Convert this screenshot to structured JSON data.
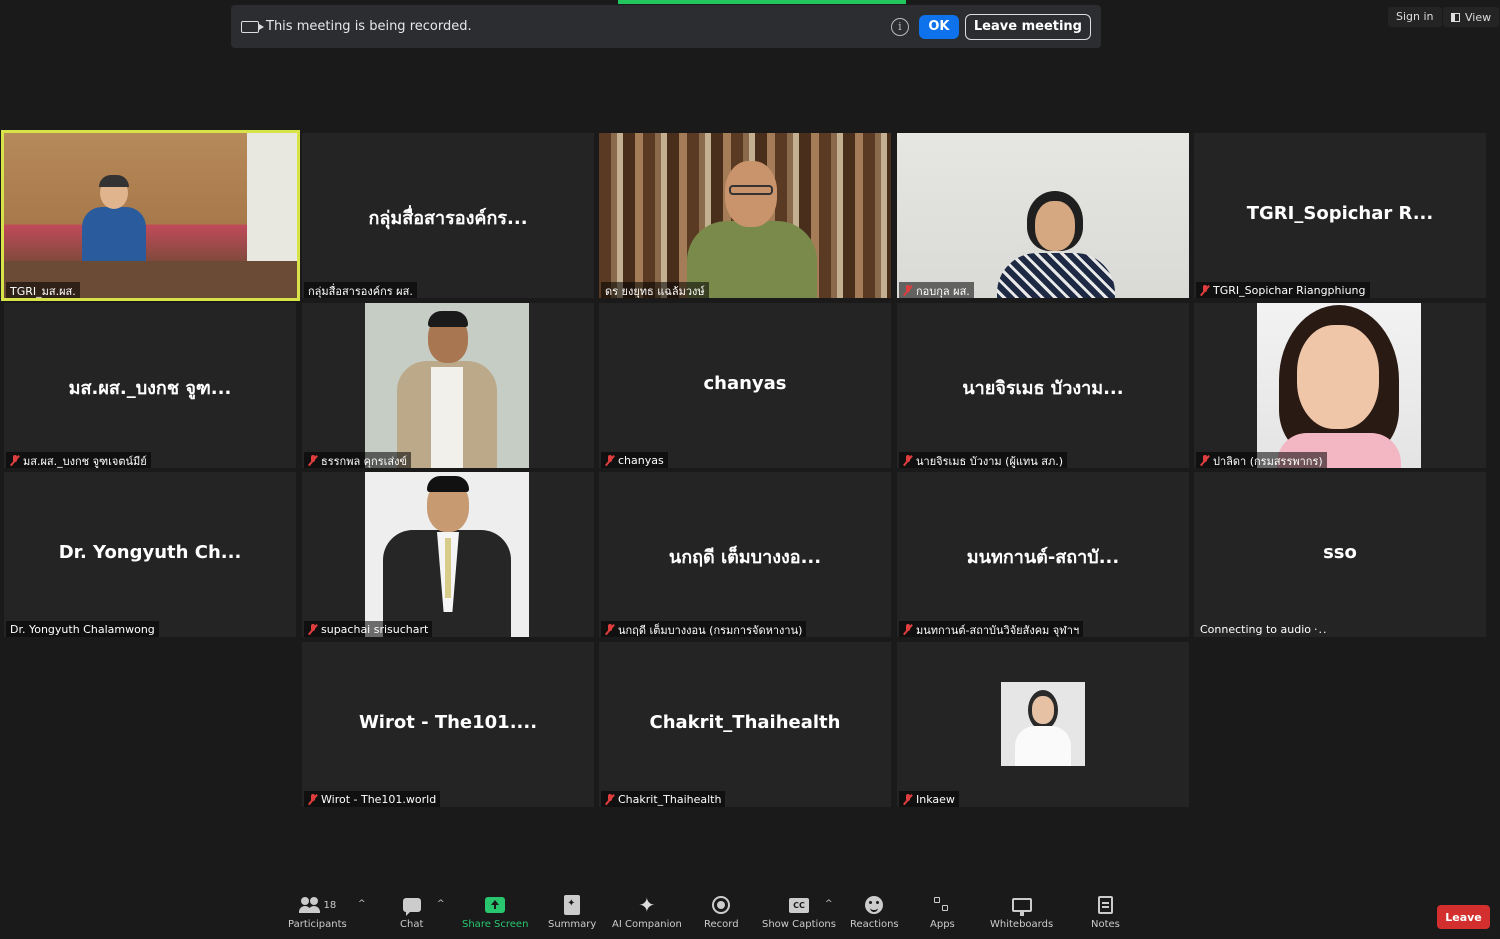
{
  "banner": {
    "text": "This meeting is being recorded.",
    "ok_label": "OK",
    "leave_meeting_label": "Leave meeting"
  },
  "top_right": {
    "sign_in_label": "Sign in",
    "view_label": "View"
  },
  "tiles": [
    {
      "display": "",
      "label": "TGRI_มส.ผส.",
      "muted": false,
      "active": true
    },
    {
      "display": "กลุ่มสื่อสารองค์กร...",
      "label": "กลุ่มสื่อสารองค์กร ผส.",
      "muted": false
    },
    {
      "display": "",
      "label": "ดร ยงยุทธ แฉล้มวงษ์",
      "muted": false
    },
    {
      "display": "",
      "label": "กอบกุล ผส.",
      "muted": true
    },
    {
      "display": "TGRI_Sopichar  R...",
      "label": "TGRI_Sopichar Riangphiung",
      "muted": true
    },
    {
      "display": "มส.ผส._บงกช จูฑ...",
      "label": "มส.ผส._บงกช จูฑเจตน์มีย์",
      "muted": true
    },
    {
      "display": "",
      "label": "ธรรกพล คุกรเส่งข์",
      "muted": true
    },
    {
      "display": "chanyas",
      "label": "chanyas",
      "muted": true
    },
    {
      "display": "นายจิรเมธ บัวงาม...",
      "label": "นายจิรเมธ บัวงาม (ผู้แทน สภ.)",
      "muted": true
    },
    {
      "display": "",
      "label": "ปาลิดา (กรมสรรพากร)",
      "muted": true
    },
    {
      "display": "Dr. Yongyuth  Ch...",
      "label": "Dr. Yongyuth Chalamwong",
      "muted": false
    },
    {
      "display": "",
      "label": "supachai srisuchart",
      "muted": true
    },
    {
      "display": "นกฤดี  เต็มบางงอ...",
      "label": "นกฤดี  เต็มบางงอน (กรมการจัดหางาน)",
      "muted": true
    },
    {
      "display": "มนทกานต์-สถาบั...",
      "label": "มนทกานต์-สถาบันวิจัยสังคม จุฬาฯ",
      "muted": true
    },
    {
      "display": "sso",
      "label": "Connecting to audio",
      "muted": false,
      "dots": "·.."
    },
    {
      "display": "Wirot  -  The101....",
      "label": "Wirot - The101.world",
      "muted": true
    },
    {
      "display": "Chakrit_Thaihealth",
      "label": "Chakrit_Thaihealth",
      "muted": true
    },
    {
      "display": "",
      "label": "Inkaew",
      "muted": true
    }
  ],
  "toolbar": {
    "participants_label": "Participants",
    "participants_count": "18",
    "chat_label": "Chat",
    "share_label": "Share Screen",
    "summary_label": "Summary",
    "ai_label": "AI Companion",
    "record_label": "Record",
    "captions_label": "Show Captions",
    "cc_text": "CC",
    "reactions_label": "Reactions",
    "apps_label": "Apps",
    "whiteboards_label": "Whiteboards",
    "notes_label": "Notes",
    "leave_label": "Leave"
  },
  "colors": {
    "active_border": "#d8e34a",
    "ok_blue": "#0e72ed",
    "share_green": "#28c76f",
    "leave_red": "#d32f2f",
    "mute_red": "#e03e3e"
  }
}
